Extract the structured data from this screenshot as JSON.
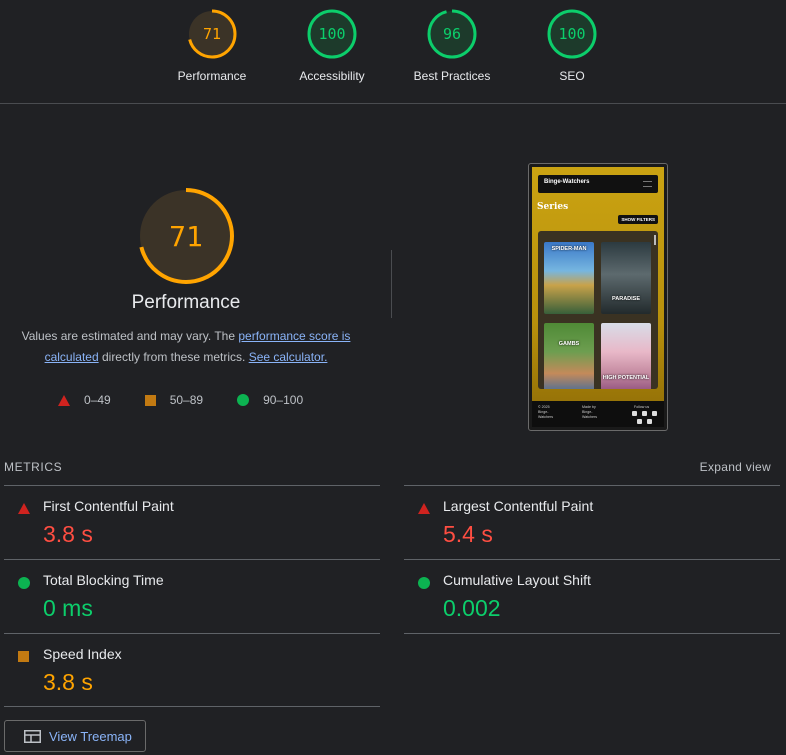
{
  "colors": {
    "fail": "#ff4e42",
    "average": "#ffa400",
    "pass": "#0cce6b",
    "link": "#8ab4f8"
  },
  "gauges": [
    {
      "label": "Performance",
      "score": "71",
      "value": 71,
      "status": "average"
    },
    {
      "label": "Accessibility",
      "score": "100",
      "value": 100,
      "status": "pass"
    },
    {
      "label": "Best Practices",
      "score": "96",
      "value": 96,
      "status": "pass"
    },
    {
      "label": "SEO",
      "score": "100",
      "value": 100,
      "status": "pass"
    }
  ],
  "performance": {
    "score": "71",
    "value": 71,
    "title": "Performance",
    "desc_prefix": "Values are estimated and may vary. The ",
    "desc_link1": "performance score is calculated",
    "desc_mid": " directly from these metrics. ",
    "desc_link2": "See calculator."
  },
  "legend": [
    {
      "range": "0–49",
      "shape": "triangle-red"
    },
    {
      "range": "50–89",
      "shape": "square-orange"
    },
    {
      "range": "90–100",
      "shape": "circle-green"
    }
  ],
  "screenshot": {
    "brand": "Binge-Watchers",
    "heading": "Series",
    "filter_button": "SHOW FILTERS",
    "posters": [
      "SPIDER-MAN",
      "PARADISE",
      "GAMBS",
      "HIGH POTENTIAL"
    ],
    "footer_left": "© 2025 Binge-Watchers",
    "footer_mid": "Made by Binge-Watchers",
    "footer_right": "Follow us"
  },
  "metrics": {
    "heading": "METRICS",
    "expand": "Expand view",
    "items": [
      {
        "name": "First Contentful Paint",
        "value": "3.8 s",
        "status": "fail"
      },
      {
        "name": "Largest Contentful Paint",
        "value": "5.4 s",
        "status": "fail"
      },
      {
        "name": "Total Blocking Time",
        "value": "0 ms",
        "status": "pass"
      },
      {
        "name": "Cumulative Layout Shift",
        "value": "0.002",
        "status": "pass"
      },
      {
        "name": "Speed Index",
        "value": "3.8 s",
        "status": "average"
      }
    ]
  },
  "treemap_button": "View Treemap",
  "icons": [
    "treemap-icon",
    "triangle-fail-icon",
    "square-average-icon",
    "circle-pass-icon"
  ]
}
